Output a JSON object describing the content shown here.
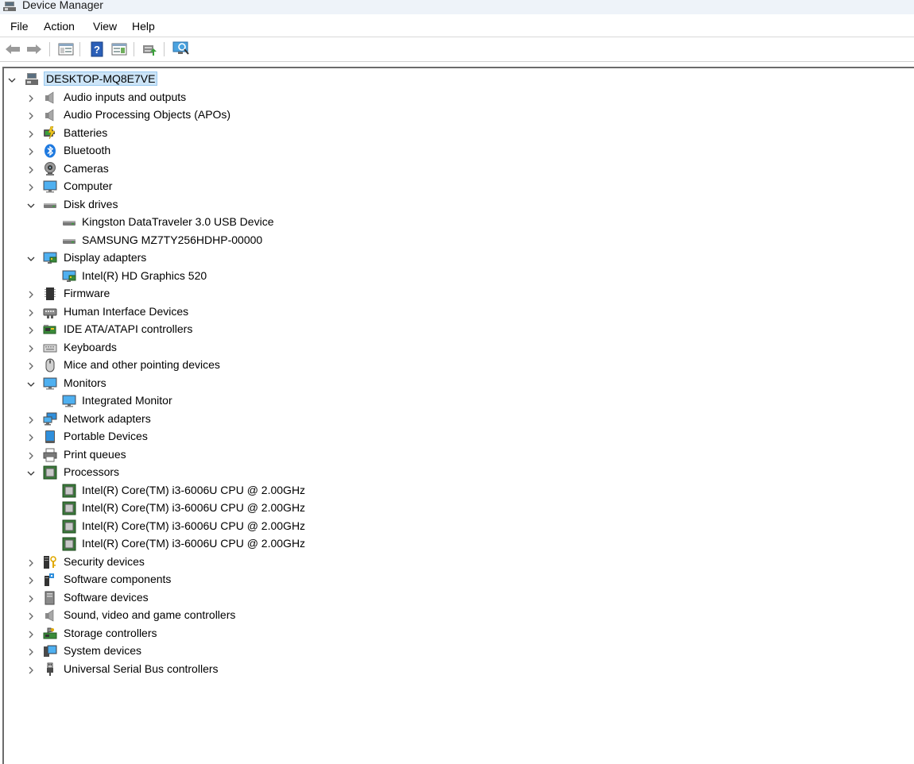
{
  "window": {
    "title": "Device Manager"
  },
  "menu": [
    "File",
    "Action",
    "View",
    "Help"
  ],
  "toolbar": [
    "back-arrow-icon",
    "forward-arrow-icon",
    "show-hide-console-tree-icon",
    "help-icon",
    "action-pane-icon",
    "update-driver-icon",
    "scan-hardware-changes-icon"
  ],
  "tree": {
    "root": "DESKTOP-MQ8E7VE",
    "items": [
      {
        "label": "Audio inputs and outputs",
        "icon": "speaker",
        "expanded": false
      },
      {
        "label": "Audio Processing Objects (APOs)",
        "icon": "speaker",
        "expanded": false
      },
      {
        "label": "Batteries",
        "icon": "battery",
        "expanded": false
      },
      {
        "label": "Bluetooth",
        "icon": "bluetooth",
        "expanded": false
      },
      {
        "label": "Cameras",
        "icon": "camera",
        "expanded": false
      },
      {
        "label": "Computer",
        "icon": "monitor",
        "expanded": false
      },
      {
        "label": "Disk drives",
        "icon": "disk",
        "expanded": true,
        "children": [
          {
            "label": "Kingston DataTraveler 3.0 USB Device",
            "icon": "disk"
          },
          {
            "label": "SAMSUNG MZ7TY256HDHP-00000",
            "icon": "disk"
          }
        ]
      },
      {
        "label": "Display adapters",
        "icon": "display",
        "expanded": true,
        "children": [
          {
            "label": "Intel(R) HD Graphics 520",
            "icon": "display"
          }
        ]
      },
      {
        "label": "Firmware",
        "icon": "chip",
        "expanded": false
      },
      {
        "label": "Human Interface Devices",
        "icon": "hid",
        "expanded": false
      },
      {
        "label": "IDE ATA/ATAPI controllers",
        "icon": "ide",
        "expanded": false
      },
      {
        "label": "Keyboards",
        "icon": "keyboard",
        "expanded": false
      },
      {
        "label": "Mice and other pointing devices",
        "icon": "mouse",
        "expanded": false
      },
      {
        "label": "Monitors",
        "icon": "monitor",
        "expanded": true,
        "children": [
          {
            "label": "Integrated Monitor",
            "icon": "monitor"
          }
        ]
      },
      {
        "label": "Network adapters",
        "icon": "network",
        "expanded": false
      },
      {
        "label": "Portable Devices",
        "icon": "portable",
        "expanded": false
      },
      {
        "label": "Print queues",
        "icon": "printer",
        "expanded": false
      },
      {
        "label": "Processors",
        "icon": "processor",
        "expanded": true,
        "children": [
          {
            "label": "Intel(R) Core(TM) i3-6006U CPU @ 2.00GHz",
            "icon": "processor"
          },
          {
            "label": "Intel(R) Core(TM) i3-6006U CPU @ 2.00GHz",
            "icon": "processor"
          },
          {
            "label": "Intel(R) Core(TM) i3-6006U CPU @ 2.00GHz",
            "icon": "processor"
          },
          {
            "label": "Intel(R) Core(TM) i3-6006U CPU @ 2.00GHz",
            "icon": "processor"
          }
        ]
      },
      {
        "label": "Security devices",
        "icon": "security",
        "expanded": false
      },
      {
        "label": "Software components",
        "icon": "software-component",
        "expanded": false
      },
      {
        "label": "Software devices",
        "icon": "software-device",
        "expanded": false
      },
      {
        "label": "Sound, video and game controllers",
        "icon": "speaker",
        "expanded": false
      },
      {
        "label": "Storage controllers",
        "icon": "storage",
        "expanded": false
      },
      {
        "label": "System devices",
        "icon": "system",
        "expanded": false
      },
      {
        "label": "Universal Serial Bus controllers",
        "icon": "usb",
        "expanded": false
      }
    ]
  }
}
